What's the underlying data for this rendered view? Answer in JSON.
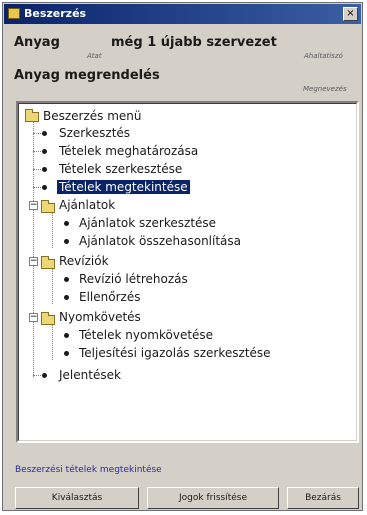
{
  "window": {
    "title": "Beszerzés",
    "close_label": "×"
  },
  "header": {
    "anyag_label": "Anyag",
    "anyag_caption": "Atat",
    "szervezet_value": "még 1 újabb szervezet",
    "szervezet_caption": "Ahaltatiszó",
    "megrendeles_label": "Anyag megrendelés",
    "megrendeles_caption": "Megnevezés"
  },
  "tree": {
    "root": "Beszerzés menü",
    "items": [
      {
        "label": "Szerkesztés"
      },
      {
        "label": "Tételek meghatározása"
      },
      {
        "label": "Tételek szerkesztése"
      },
      {
        "label": "Tételek megtekintése",
        "selected": true
      }
    ],
    "ajanlatok": {
      "label": "Ajánlatok",
      "children": [
        "Ajánlatok szerkesztése",
        "Ajánlatok összehasonlítása"
      ]
    },
    "reviziok": {
      "label": "Revíziók",
      "children": [
        "Revízió létrehozás",
        "Ellenőrzés"
      ]
    },
    "nyomkovetes": {
      "label": "Nyomkövetés",
      "children": [
        "Tételek nyomkövetése",
        "Teljesítési igazolás szerkesztése"
      ]
    },
    "jelentesek": "Jelentések"
  },
  "status_text": "Beszerzési tételek megtekintése",
  "buttons": {
    "select": "Kiválasztás",
    "refresh": "Jogok frissítése",
    "close": "Bezárás"
  }
}
